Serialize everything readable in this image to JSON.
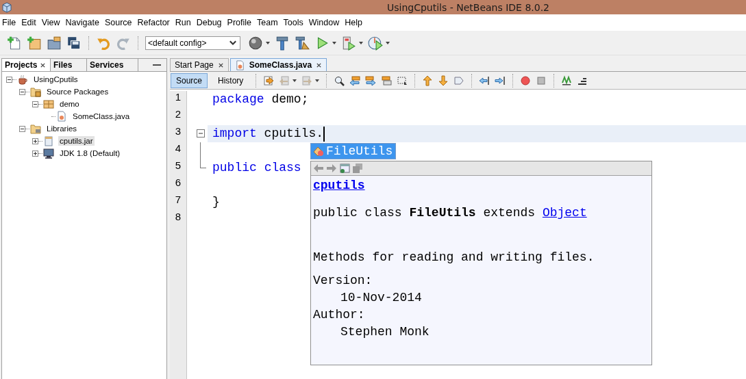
{
  "window": {
    "title": "UsingCputils - NetBeans IDE 8.0.2"
  },
  "menu": [
    "File",
    "Edit",
    "View",
    "Navigate",
    "Source",
    "Refactor",
    "Run",
    "Debug",
    "Profile",
    "Team",
    "Tools",
    "Window",
    "Help"
  ],
  "toolbar": {
    "config": "<default config>"
  },
  "projects_panel": {
    "tabs": [
      {
        "label": "Projects",
        "selected": true
      },
      {
        "label": "Files",
        "selected": false
      },
      {
        "label": "Services",
        "selected": false
      }
    ],
    "tree": [
      {
        "label": "UsingCputils",
        "kind": "project",
        "expanded": true,
        "selected": false,
        "children": [
          {
            "label": "Source Packages",
            "kind": "source-packages",
            "expanded": true,
            "selected": false,
            "children": [
              {
                "label": "demo",
                "kind": "package",
                "expanded": true,
                "selected": false,
                "children": [
                  {
                    "label": "SomeClass.java",
                    "kind": "java-file",
                    "selected": false
                  }
                ]
              }
            ]
          },
          {
            "label": "Libraries",
            "kind": "libraries",
            "expanded": true,
            "selected": false,
            "children": [
              {
                "label": "cputils.jar",
                "kind": "jar",
                "expanded": false,
                "selected": true
              },
              {
                "label": "JDK 1.8 (Default)",
                "kind": "jdk",
                "expanded": false,
                "selected": false
              }
            ]
          }
        ]
      }
    ]
  },
  "editor": {
    "tabs": [
      {
        "label": "Start Page",
        "selected": false
      },
      {
        "label": "SomeClass.java",
        "selected": true
      }
    ],
    "views": [
      {
        "label": "Source",
        "selected": true
      },
      {
        "label": "History",
        "selected": false
      }
    ],
    "lines": [
      {
        "number": "1",
        "kind": "plain",
        "current": false,
        "cursor": false,
        "tokens": [
          {
            "text": "package",
            "kind": "keyword"
          },
          {
            "text": " demo;",
            "kind": "plain"
          }
        ]
      },
      {
        "number": "2",
        "kind": "plain",
        "current": false,
        "cursor": false
      },
      {
        "number": "3",
        "kind": "opener",
        "current": true,
        "cursor": true,
        "tokens": [
          {
            "text": "import",
            "kind": "keyword"
          },
          {
            "text": " cputils.",
            "kind": "plain"
          }
        ]
      },
      {
        "number": "4",
        "kind": "inner",
        "current": false,
        "cursor": false
      },
      {
        "number": "5",
        "kind": "closer",
        "current": false,
        "cursor": false,
        "tokens": [
          {
            "text": "public ",
            "kind": "keyword"
          },
          {
            "text": "class",
            "kind": "keyword"
          }
        ]
      },
      {
        "number": "6",
        "kind": "plain",
        "current": false,
        "cursor": false
      },
      {
        "number": "7",
        "kind": "plain",
        "current": false,
        "cursor": false,
        "tokens": [
          {
            "text": "}",
            "kind": "plain"
          }
        ]
      },
      {
        "number": "8",
        "kind": "plain",
        "current": false,
        "cursor": false
      }
    ]
  },
  "completion": {
    "items": [
      {
        "label": "FileUtils",
        "selected": true
      }
    ]
  },
  "doc": {
    "package": "cputils",
    "signature": "public class **FileUtils** extends ",
    "supertype": "Object",
    "description": "Methods for reading and writing files.",
    "tags": [
      {
        "label": "Version:",
        "value": "10-Nov-2014"
      },
      {
        "label": "Author:",
        "value": "Stephen Monk"
      }
    ]
  }
}
